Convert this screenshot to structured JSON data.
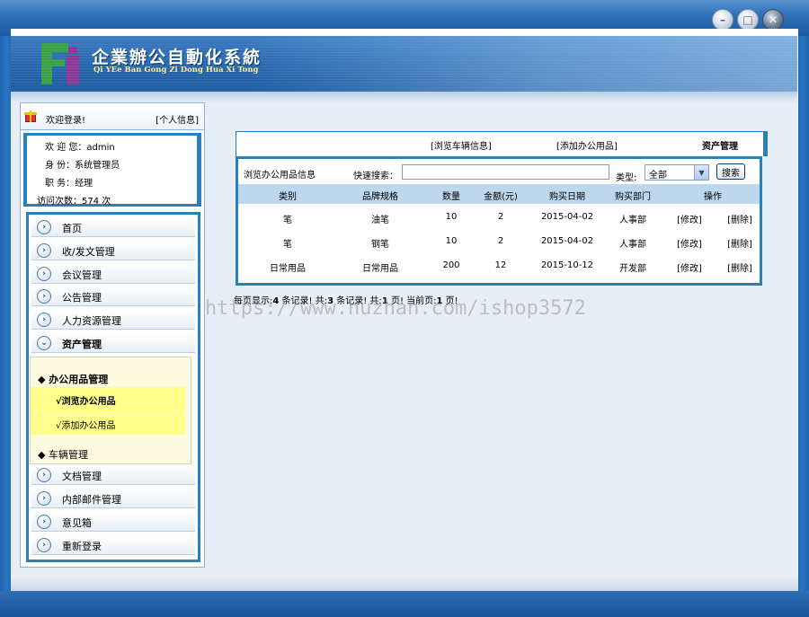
{
  "window": {
    "min_glyph": "–",
    "max_glyph": "□",
    "close_glyph": "✕"
  },
  "header": {
    "title": "企業辦公自動化系統",
    "subtitle": "Qi YEe Ban Gong Zi Dong Hua Xi Tong"
  },
  "sidebar": {
    "welcome": "欢迎登录!",
    "profile_link": "[个人信息]",
    "user": {
      "line1": "欢 迎 您：admin",
      "line2": "身    份：系统管理员",
      "line3": "职    务：经理",
      "line4": "访问次数：574 次"
    },
    "menu": {
      "item0": "首页",
      "item1": "收/发文管理",
      "item2": "会议管理",
      "item3": "公告管理",
      "item4": "人力资源管理",
      "item5": "资产管理",
      "item6": "文档管理",
      "item7": "内部邮件管理",
      "item8": "意见箱",
      "item9": "重新登录"
    },
    "submenu": {
      "group1": "◆ 办公用品管理",
      "browse": "√浏览办公用品",
      "add": "√添加办公用品",
      "group2": "◆ 车辆管理"
    }
  },
  "tabs": {
    "vehicle": "[浏览车辆信息]",
    "add_supply": "[添加办公用品]",
    "current": "资产管理"
  },
  "toolbar": {
    "title": "浏览办公用品信息",
    "search_label": "快速搜索：",
    "search_value": "",
    "type_label": "类型:",
    "type_value": "全部",
    "search_button": "搜索"
  },
  "table": {
    "headers": [
      "类别",
      "品牌规格",
      "数量",
      "金额(元)",
      "购买日期",
      "购买部门",
      "操作"
    ],
    "edit": "[修改]",
    "delete": "[删除]",
    "rows": [
      [
        "笔",
        "油笔",
        "10",
        "2",
        "2015-04-02",
        "人事部"
      ],
      [
        "笔",
        "钢笔",
        "10",
        "2",
        "2015-04-02",
        "人事部"
      ],
      [
        "日常用品",
        "日常用品",
        "200",
        "12",
        "2015-10-12",
        "开发部"
      ]
    ]
  },
  "pager": {
    "p1": "每页显示:",
    "per_page": "4",
    "p2": " 条记录! 共:",
    "total": "3",
    "p3": " 条记录! 共:",
    "pages": "1",
    "p4": " 页! 当前页:",
    "current": "1",
    "p5": " 页!"
  },
  "watermark": "https://www.huzhan.com/ishop3572"
}
